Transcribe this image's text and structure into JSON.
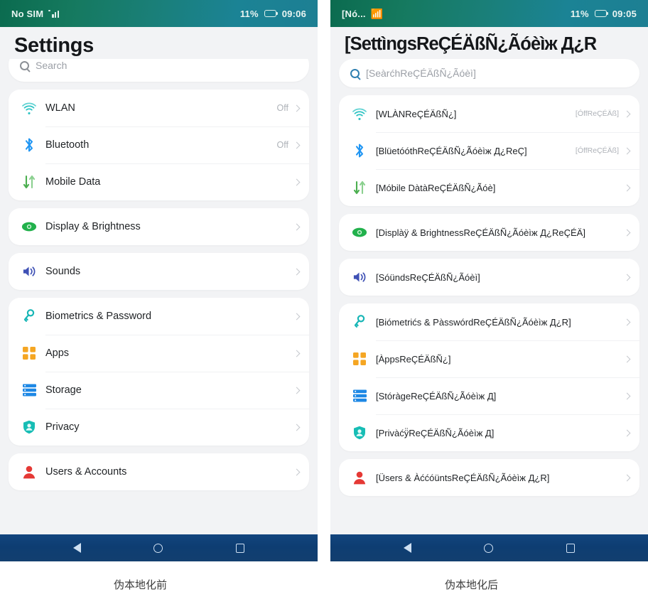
{
  "captions": {
    "before": "伪本地化前",
    "after": "伪本地化后"
  },
  "colors": {
    "status_bar_start": "#0b6b4f",
    "status_bar_end": "#1d7f93",
    "nav_bar": "#12457e",
    "page_bg": "#f2f3f5",
    "card_bg": "#ffffff",
    "title_text": "#15171a",
    "value_text": "#aeb2b8",
    "icon_wlan": "#2ec4c4",
    "icon_bluetooth": "#2196f3",
    "icon_mobile_data": "#4caf50",
    "icon_display": "#22b14c",
    "icon_sounds": "#3f51b5",
    "icon_biometrics": "#18b6b6",
    "icon_apps": "#f5a623",
    "icon_storage": "#1e88e5",
    "icon_privacy": "#17bdb5",
    "icon_users": "#e53935"
  },
  "left_phone": {
    "status": {
      "carrier": "No SIM",
      "signal_icon": "signal-bars-icon",
      "battery_percent": "11%",
      "battery_icon": "battery-icon",
      "time": "09:06"
    },
    "title": "Settings",
    "search": {
      "placeholder": "Search",
      "icon": "search-icon"
    },
    "groups": [
      {
        "rows": [
          {
            "icon": "wifi-icon",
            "label": "WLAN",
            "value": "Off"
          },
          {
            "icon": "bluetooth-icon",
            "label": "Bluetooth",
            "value": "Off"
          },
          {
            "icon": "mobile-data-icon",
            "label": "Mobile Data",
            "value": ""
          }
        ]
      },
      {
        "rows": [
          {
            "icon": "display-icon",
            "label": "Display & Brightness",
            "value": ""
          }
        ]
      },
      {
        "rows": [
          {
            "icon": "sound-icon",
            "label": "Sounds",
            "value": ""
          }
        ]
      },
      {
        "rows": [
          {
            "icon": "key-icon",
            "label": "Biometrics & Password",
            "value": ""
          },
          {
            "icon": "apps-icon",
            "label": "Apps",
            "value": ""
          },
          {
            "icon": "storage-icon",
            "label": "Storage",
            "value": ""
          },
          {
            "icon": "privacy-icon",
            "label": "Privacy",
            "value": ""
          }
        ]
      },
      {
        "rows": [
          {
            "icon": "user-icon",
            "label": "Users & Accounts",
            "value": ""
          }
        ]
      }
    ],
    "nav": {
      "back": "back-icon",
      "home": "home-icon",
      "recents": "recents-icon"
    }
  },
  "right_phone": {
    "status": {
      "carrier": "[Nó...",
      "signal_icon": "signal-bars-icon",
      "battery_percent": "11%",
      "battery_icon": "battery-icon",
      "time": "09:05"
    },
    "title": "[SettìngsReÇÉÄßÑ¿Ãóèìж Д¿R",
    "search": {
      "placeholder": "[SeàrćhReÇÉÄßÑ¿Ãóèì]",
      "icon": "search-icon"
    },
    "groups": [
      {
        "rows": [
          {
            "icon": "wifi-icon",
            "label": "[WLÀNReÇÉÄßÑ¿]",
            "value": "[ÓffReÇÉÄß]"
          },
          {
            "icon": "bluetooth-icon",
            "label": "[BlüetóóthReÇÉÄßÑ¿Ãóèìж Д¿ReÇ]",
            "value": "[ÓffReÇÉÄß]"
          },
          {
            "icon": "mobile-data-icon",
            "label": "[Móbile DàtàReÇÉÄßÑ¿Ãóè]",
            "value": ""
          }
        ]
      },
      {
        "rows": [
          {
            "icon": "display-icon",
            "label": "[Displàÿ & BrightnessReÇÉÄßÑ¿Ãóèìж Д¿ReÇÉÄ]",
            "value": ""
          }
        ]
      },
      {
        "rows": [
          {
            "icon": "sound-icon",
            "label": "[SóündsReÇÉÄßÑ¿Ãóèì]",
            "value": ""
          }
        ]
      },
      {
        "rows": [
          {
            "icon": "key-icon",
            "label": "[Biómetrićs & PàsswórdReÇÉÄßÑ¿Ãóèìж Д¿R]",
            "value": ""
          },
          {
            "icon": "apps-icon",
            "label": "[ÀppsReÇÉÄßÑ¿]",
            "value": ""
          },
          {
            "icon": "storage-icon",
            "label": "[StóràgeReÇÉÄßÑ¿Ãóèìж Д]",
            "value": ""
          },
          {
            "icon": "privacy-icon",
            "label": "[Privàćÿ̈ReÇÉÄßÑ¿Ãóèìж Д]",
            "value": ""
          }
        ]
      },
      {
        "rows": [
          {
            "icon": "user-icon",
            "label": "[Üsers & ÀććóüntsReÇÉÄßÑ¿Ãóèìж Д¿R]",
            "value": ""
          }
        ]
      }
    ],
    "nav": {
      "back": "back-icon",
      "home": "home-icon",
      "recents": "recents-icon"
    }
  }
}
